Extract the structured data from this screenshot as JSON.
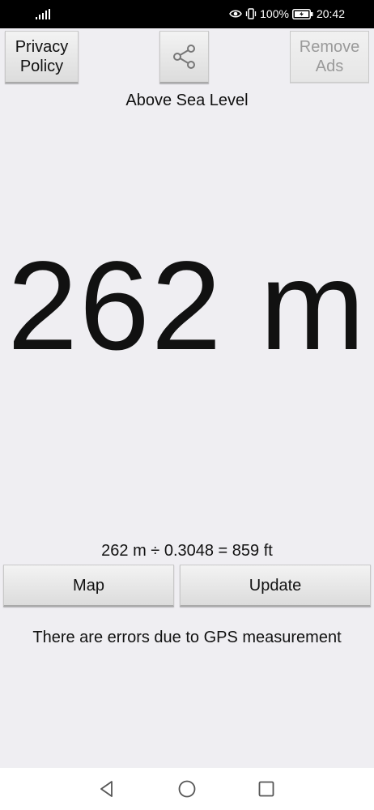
{
  "status_bar": {
    "battery_percent": "100%",
    "time": "20:42",
    "icons": [
      "signal-icon",
      "eye-icon",
      "vibrate-icon",
      "battery-charging-icon"
    ]
  },
  "header": {
    "privacy_label": "Privacy\nPolicy",
    "share_icon": "share-icon",
    "remove_ads_label": "Remove\nAds"
  },
  "main": {
    "subtitle": "Above Sea Level",
    "altitude": "262 m",
    "conversion": "262 m ÷ 0.3048 = 859 ft",
    "note": "There are errors due to GPS measurement"
  },
  "actions": {
    "map_label": "Map",
    "update_label": "Update"
  },
  "nav_bar": {
    "icons": [
      "back-icon",
      "home-icon",
      "recents-icon"
    ]
  },
  "colors": {
    "background": "#efeef2",
    "status_bar": "#000000",
    "disabled_text": "#9a9a9a"
  }
}
